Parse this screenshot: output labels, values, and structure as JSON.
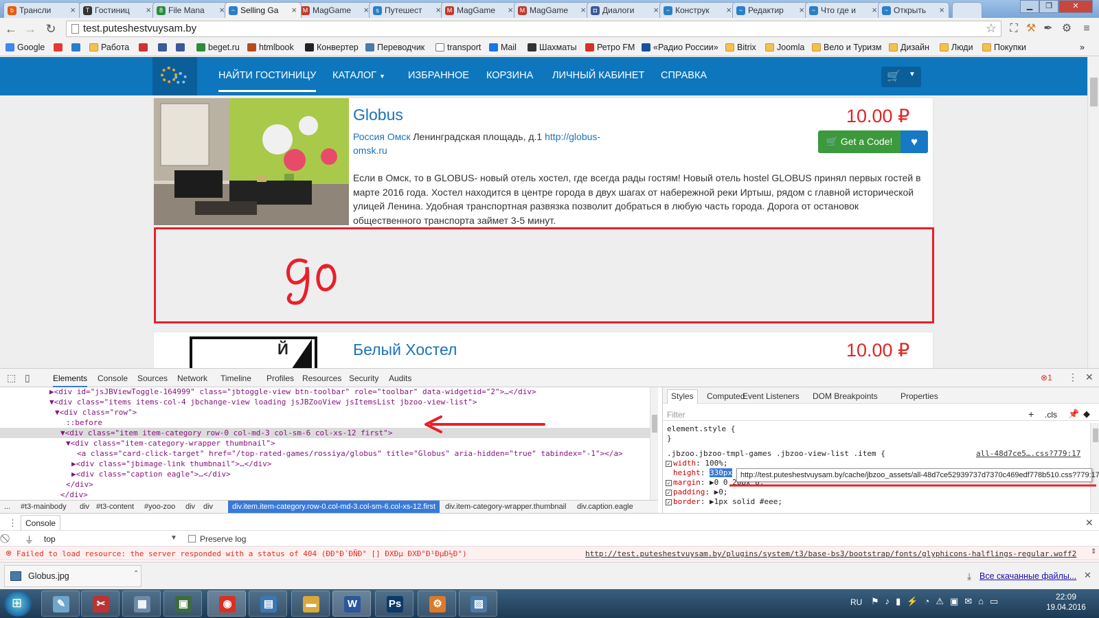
{
  "browser": {
    "tabs": [
      {
        "label": "Трансли",
        "fav": "b",
        "fav_color": "#e8590c"
      },
      {
        "label": "Гостиниц",
        "fav": "T",
        "fav_color": "#333333"
      },
      {
        "label": "File Mana",
        "fav": "8",
        "fav_color": "#2d8c3c"
      },
      {
        "label": "Selling Ga",
        "fav": "~",
        "fav_color": "#2a7fc9"
      },
      {
        "label": "MagGame",
        "fav": "M",
        "fav_color": "#c0392b"
      },
      {
        "label": "Путешест",
        "fav": "s",
        "fav_color": "#2a7fc9"
      },
      {
        "label": "MagGame",
        "fav": "M",
        "fav_color": "#c0392b"
      },
      {
        "label": "MagGame",
        "fav": "M",
        "fav_color": "#c0392b"
      },
      {
        "label": "Диалоги",
        "fav": "◘",
        "fav_color": "#3b5998"
      },
      {
        "label": "Конструк",
        "fav": "~",
        "fav_color": "#2a7fc9"
      },
      {
        "label": "Редактир",
        "fav": "~",
        "fav_color": "#2a7fc9"
      },
      {
        "label": "Что где и",
        "fav": "~",
        "fav_color": "#2a7fc9"
      },
      {
        "label": "Открыть",
        "fav": "~",
        "fav_color": "#2a7fc9"
      }
    ],
    "url": "test.puteshestvuysam.by",
    "bookmarks": [
      {
        "label": "Google",
        "type": "google"
      },
      {
        "label": "",
        "type": "yandex"
      },
      {
        "label": "",
        "type": "globe"
      },
      {
        "label": "Работа",
        "type": "folder"
      },
      {
        "label": "",
        "type": "rus"
      },
      {
        "label": "",
        "type": "play"
      },
      {
        "label": "",
        "type": "fb"
      },
      {
        "label": "beget.ru",
        "type": "beget"
      },
      {
        "label": "htmlbook",
        "type": "html"
      },
      {
        "label": "Конвертер",
        "type": "conv"
      },
      {
        "label": "Переводчик",
        "type": "trans"
      },
      {
        "label": "transport",
        "type": "page"
      },
      {
        "label": "Mail",
        "type": "mail"
      },
      {
        "label": "Шахматы",
        "type": "chess"
      },
      {
        "label": "Ретро FM",
        "type": "retro"
      },
      {
        "label": "«Радио России»",
        "type": "radio"
      },
      {
        "label": "Bitrix",
        "type": "folder"
      },
      {
        "label": "Joomla",
        "type": "folder"
      },
      {
        "label": "Вело и Туризм",
        "type": "folder"
      },
      {
        "label": "Дизайн",
        "type": "folder"
      },
      {
        "label": "Люди",
        "type": "folder"
      },
      {
        "label": "Покупки",
        "type": "folder"
      }
    ],
    "bookmarks_overflow": "»"
  },
  "site": {
    "nav": [
      {
        "label": "НАЙТИ ГОСТИНИЦУ",
        "active": true
      },
      {
        "label": "КАТАЛОГ",
        "dropdown": true
      },
      {
        "label": "ИЗБРАННОЕ"
      },
      {
        "label": "КОРЗИНА"
      },
      {
        "label": "ЛИЧНЫЙ КАБИНЕТ"
      },
      {
        "label": "СПРАВКА"
      }
    ],
    "colors": {
      "nav_bg": "#0e76bd",
      "price": "#e02424",
      "link": "#1b72b8",
      "get_code": "#3c9a3c",
      "annotation": "#e8202a"
    },
    "listings": [
      {
        "title": "Globus",
        "price": "10.00 ₽",
        "country": "Россия",
        "city": "Омск",
        "address": "Ленинградская площадь, д.1",
        "url_line1": "http://globus-",
        "url_line2": "omsk.ru",
        "description": "Если в Омск, то в GLOBUS- новый отель хостел, где всегда рады гостям! Новый отель hostel GLOBUS принял первых гостей в марте 2016 года. Хостел находится в центре города в двух шагах от набережной реки Иртыш, рядом с главной исторической улицей Ленина. Удобная транспортная развязка позволит добраться в любую часть города. Дорога от остановок общественного транспорта займет 3-5 минут.",
        "button_label": "Get a Code!"
      },
      {
        "title": "Белый Хостел",
        "price": "10.00 ₽"
      }
    ],
    "annotation_text": "go"
  },
  "devtools": {
    "tabs": [
      "Elements",
      "Console",
      "Sources",
      "Network",
      "Timeline",
      "Profiles",
      "Resources",
      "Security",
      "Audits"
    ],
    "error_count": "1",
    "dom_lines": [
      {
        "indent": 9,
        "html": "▶<div id=\"jsJBViewToggle-164999\" class=\"jbtoggle-view btn-toolbar\" role=\"toolbar\" data-widgetid=\"2\">…</div>"
      },
      {
        "indent": 9,
        "html": "▼<div class=\"items items-col-4 jbchange-view loading jsJBZooView jsItemsList jbzoo-view-list\">"
      },
      {
        "indent": 10,
        "html": "▼<div class=\"row\">"
      },
      {
        "indent": 12,
        "html": "::before"
      },
      {
        "indent": 11,
        "html": "▼<div class=\"item item-category row-0 col-md-3 col-sm-6 col-xs-12 first\">",
        "selected": true
      },
      {
        "indent": 12,
        "html": "▼<div class=\"item-category-wrapper thumbnail\">"
      },
      {
        "indent": 14,
        "html": "<a class=\"card-click-target\" href=\"/top-rated-games/rossiya/globus\" title=\"Globus\" aria-hidden=\"true\" tabindex=\"-1\"></a>"
      },
      {
        "indent": 13,
        "html": "▶<div class=\"jbimage-link thumbnail\">…</div>"
      },
      {
        "indent": 13,
        "html": "▶<div class=\"caption eagle\">…</div>"
      },
      {
        "indent": 12,
        "html": "</div>"
      },
      {
        "indent": 11,
        "html": "</div>"
      }
    ],
    "breadcrumbs": [
      "...",
      "#t3-mainbody",
      "div",
      "#t3-content",
      "#yoo-zoo",
      "div",
      "div",
      "div.item.item-category.row-0.col-md-3.col-sm-6.col-xs-12.first",
      "div.item-category-wrapper.thumbnail",
      "div.caption.eagle"
    ],
    "styles_tabs": [
      "Styles",
      "Computed",
      "Event Listeners",
      "DOM Breakpoints",
      "Properties"
    ],
    "filter_placeholder": "Filter",
    "cls_label": ".cls",
    "element_style": "element.style {",
    "close_brace": "}",
    "rule_selector": ".jbzoo.jbzoo-tmpl-games .jbzoo-view-list .item {",
    "rule_source": "all-48d7ce5….css?779:17",
    "declarations": [
      {
        "prop": "width",
        "value": "100%;"
      },
      {
        "prop": "height",
        "value": "330px"
      },
      {
        "prop": "margin",
        "value": "▶0 0 20px 0;"
      },
      {
        "prop": "padding",
        "value": "▶0;"
      },
      {
        "prop": "border",
        "value": "▶1px solid  #eee;"
      }
    ],
    "tooltip": "http://test.puteshestvuysam.by/cache/jbzoo_assets/all-48d7ce52939737d7370c469edf778b510.css?779:17",
    "drawer_tab": "Console",
    "console_context": "top",
    "preserve_log": "Preserve log",
    "console_error": "Failed to load resource: the server responded with a status of 404 (ÐÐ°Ð´ÐÑÐ° [] ÐXÐµ ÐXÐ°Ð¹ÐµÐ½Ð°)",
    "console_error_source": "http://test.puteshestvuysam.by/plugins/system/t3/base-bs3/bootstrap/fonts/glyphicons-halflings-regular.woff2"
  },
  "downloads": {
    "file": "Globus.jpg",
    "all_label": "Все скачанные файлы..."
  },
  "taskbar": {
    "lang": "RU",
    "time": "22:09",
    "date": "19.04.2016",
    "apps": [
      {
        "name": "notepad",
        "glyph": "✎",
        "color": "#6fa6c9"
      },
      {
        "name": "paint",
        "glyph": "✂",
        "color": "#b33"
      },
      {
        "name": "calculator",
        "glyph": "▦",
        "color": "#6d8aa8"
      },
      {
        "name": "monitor",
        "glyph": "▣",
        "color": "#3d6b3d"
      },
      {
        "name": "chrome",
        "glyph": "◉",
        "color": "#d93025"
      },
      {
        "name": "control-panel",
        "glyph": "▤",
        "color": "#3b77b5"
      },
      {
        "name": "explorer",
        "glyph": "▬",
        "color": "#d9a93a"
      },
      {
        "name": "word",
        "glyph": "W",
        "color": "#2b579a"
      },
      {
        "name": "photoshop",
        "glyph": "Ps",
        "color": "#0a3a66"
      },
      {
        "name": "tool",
        "glyph": "⚙",
        "color": "#d97b2b"
      },
      {
        "name": "image-viewer",
        "glyph": "▨",
        "color": "#4a7aa8"
      }
    ]
  }
}
